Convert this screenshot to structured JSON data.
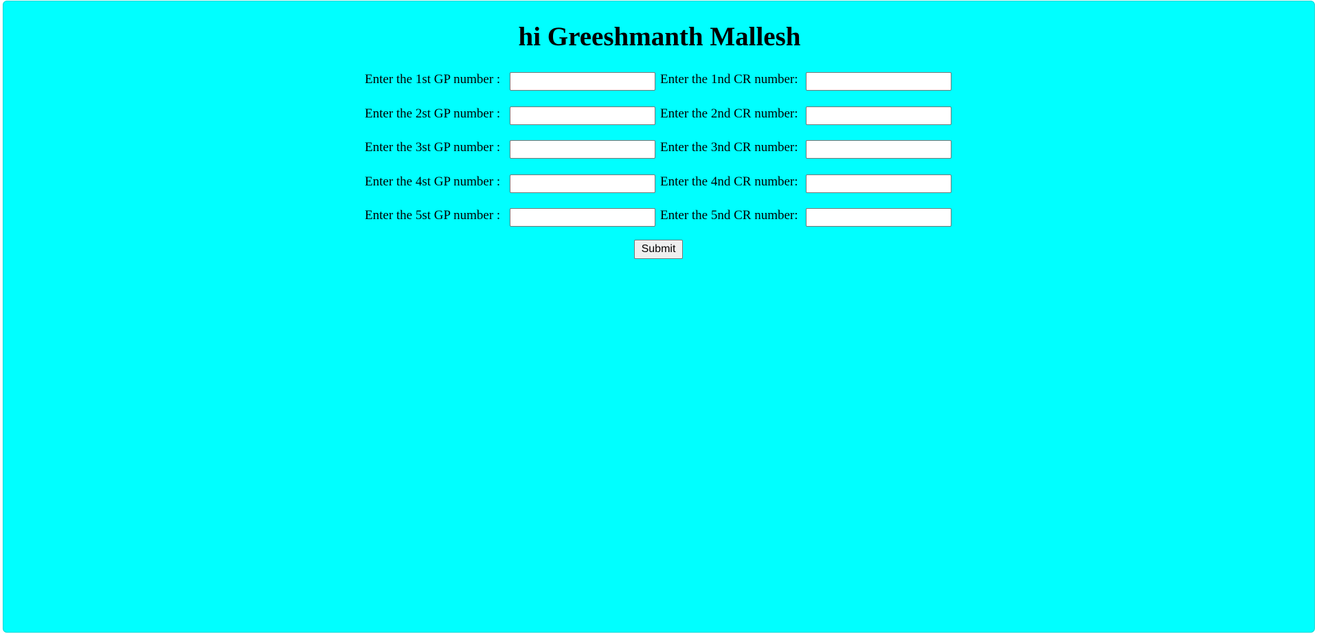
{
  "page": {
    "title": "hi Greeshmanth Mallesh",
    "background_color": "#00ffff"
  },
  "form": {
    "rows": [
      {
        "gp_label": "Enter the 1st GP number :",
        "gp_value": "",
        "cr_label": "Enter the 1nd CR number:",
        "cr_value": ""
      },
      {
        "gp_label": "Enter the 2st GP number :",
        "gp_value": "",
        "cr_label": "Enter the 2nd CR number:",
        "cr_value": ""
      },
      {
        "gp_label": "Enter the 3st GP number :",
        "gp_value": "",
        "cr_label": "Enter the 3nd CR number:",
        "cr_value": ""
      },
      {
        "gp_label": "Enter the 4st GP number :",
        "gp_value": "",
        "cr_label": "Enter the 4nd CR number:",
        "cr_value": ""
      },
      {
        "gp_label": "Enter the 5st GP number :",
        "gp_value": "",
        "cr_label": "Enter the 5nd CR number:",
        "cr_value": ""
      }
    ],
    "submit_label": "Submit"
  }
}
